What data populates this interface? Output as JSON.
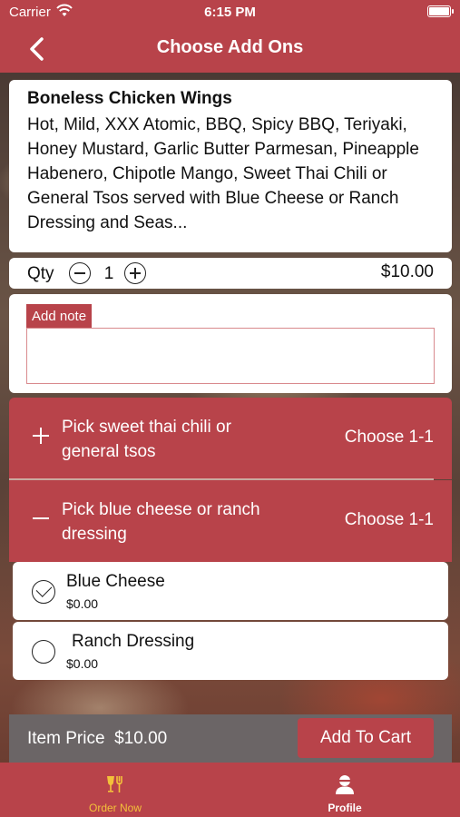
{
  "status_bar": {
    "carrier": "Carrier",
    "time": "6:15 PM"
  },
  "nav": {
    "title": "Choose Add Ons",
    "back_icon": "chevron-left-icon"
  },
  "item": {
    "name": "Boneless Chicken Wings",
    "description": "Hot, Mild, XXX Atomic, BBQ, Spicy BBQ, Teriyaki, Honey Mustard, Garlic Butter Parmesan, Pineapple Habenero, Chipotle Mango, Sweet Thai Chili or General Tsos served with Blue Cheese or Ranch Dressing and Seas..."
  },
  "quantity": {
    "label": "Qty",
    "value": "1",
    "price": "$10.00"
  },
  "note": {
    "label": "Add note",
    "value": ""
  },
  "groups": [
    {
      "icon": "plus-icon",
      "title": "Pick sweet thai chili or general tsos",
      "choose": "Choose 1-1",
      "expanded": false
    },
    {
      "icon": "minus-icon",
      "title": "Pick blue cheese or ranch dressing",
      "choose": "Choose 1-1",
      "expanded": true
    }
  ],
  "options": [
    {
      "name": "Blue Cheese",
      "price": "$0.00",
      "selected": true
    },
    {
      "name": "Ranch Dressing",
      "price": "$0.00",
      "selected": false
    }
  ],
  "footer": {
    "item_price_label": "Item Price",
    "item_price": "$10.00",
    "add_to_cart": "Add To Cart"
  },
  "tabs": [
    {
      "label": "Order Now",
      "icon": "fork-glass-icon",
      "active": true
    },
    {
      "label": "Profile",
      "icon": "person-icon",
      "active": false
    }
  ],
  "colors": {
    "brand": "#b8434a",
    "active_tab": "#f3c13a",
    "footer": "#6b6566"
  }
}
